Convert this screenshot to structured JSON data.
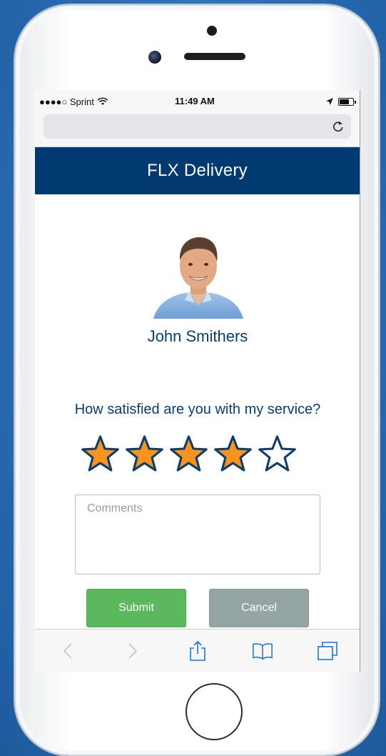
{
  "status_bar": {
    "carrier": "●●●●○ Sprint",
    "time": "11:49 AM",
    "battery_level": 0.7
  },
  "header": {
    "title": "FLX Delivery"
  },
  "driver": {
    "name": "John Smithers"
  },
  "rating": {
    "question": "How satisfied are you with my service?",
    "value": 4,
    "max": 5,
    "filled_color": "#f7941d",
    "outline_color": "#0b3d6e"
  },
  "comments": {
    "placeholder": "Comments",
    "value": ""
  },
  "buttons": {
    "submit_label": "Submit",
    "cancel_label": "Cancel"
  },
  "colors": {
    "brand": "#003a70",
    "submit": "#5cb85c",
    "cancel": "#95a5a6"
  },
  "toolbar_icons": [
    "back-icon",
    "forward-icon",
    "share-icon",
    "bookmarks-icon",
    "tabs-icon"
  ]
}
